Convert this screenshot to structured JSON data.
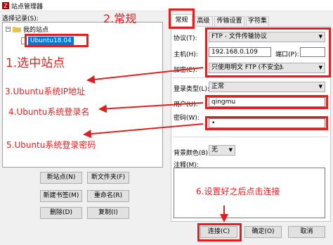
{
  "window": {
    "title": "站点管理器"
  },
  "left": {
    "label": "选择记录(S):",
    "tree": {
      "root": "我的站点",
      "child": "Ubuntu18.04"
    },
    "buttons": {
      "new_site": "新站点(N)",
      "new_folder": "新文件夹(F)",
      "new_bookmark": "新建书签(M)",
      "rename": "重命名(R)",
      "delete": "删除(D)",
      "copy": "复制(I)"
    }
  },
  "tabs": [
    "常规",
    "高级",
    "传输设置",
    "字符集"
  ],
  "form": {
    "protocol_label": "协议(T):",
    "protocol_value": "FTP - 文件传输协议",
    "host_label": "主机(H):",
    "host_value": "192.168.0.109",
    "port_label": "端口(P):",
    "port_value": "",
    "encryption_label": "加密(E):",
    "encryption_value": "只使用明文 FTP (不安全)",
    "logon_label": "登录类型(L):",
    "logon_value": "正常",
    "user_label": "用户(U):",
    "user_value": "qingmu",
    "password_label": "密码(W):",
    "password_value": "•",
    "bg_label": "背景颜色(B):",
    "bg_value": "无",
    "comment_label": "注释(M):"
  },
  "footer": {
    "connect": "连接(C)",
    "ok": "确定(O)",
    "cancel": "取消"
  },
  "annotations": {
    "a1": "1.选中站点",
    "a2": "2.常规",
    "a3": "3.Ubuntu系统IP地址",
    "a4": "4.Ubuntu系统登录名",
    "a5": "5.Ubuntu系统登录密码",
    "a6": "6.设置好之后点击连接"
  },
  "colors": {
    "annotation": "#e02020",
    "selection": "#0078d7"
  }
}
